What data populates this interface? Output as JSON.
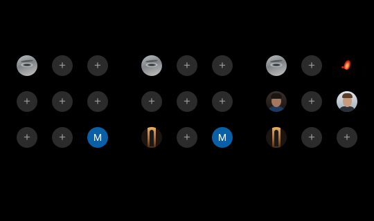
{
  "screen": "story-highlights-grid",
  "add_glyph": "+",
  "avatar_letter": "M",
  "colors": {
    "background": "#000000",
    "add_slot": "#2b2b2b",
    "add_glyph": "#9b9b9b",
    "letter_avatar": "#0b5fa5"
  },
  "grids": [
    {
      "rows": [
        [
          "photo-eye",
          "add",
          "add"
        ],
        [
          "add",
          "add",
          "add"
        ],
        [
          "add",
          "add",
          "letter"
        ]
      ]
    },
    {
      "rows": [
        [
          "photo-eye",
          "add",
          "add"
        ],
        [
          "add",
          "add",
          "add"
        ],
        [
          "photo-figure",
          "add",
          "letter"
        ]
      ]
    },
    {
      "rows": [
        [
          "photo-eye",
          "add",
          "photo-fire"
        ],
        [
          "photo-man",
          "add",
          "photo-portrait"
        ],
        [
          "photo-figure",
          "add",
          "add"
        ]
      ]
    }
  ]
}
